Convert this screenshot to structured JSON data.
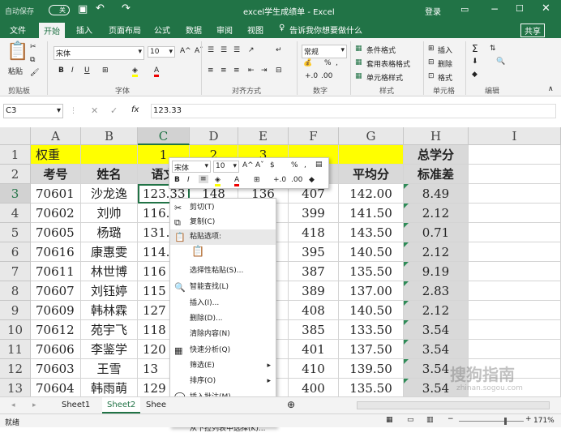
{
  "title": {
    "autosave": "自动保存",
    "autosave_state": "关",
    "filename": "excel学生成绩单 - Excel",
    "login": "登录"
  },
  "tabs": [
    "文件",
    "开始",
    "插入",
    "页面布局",
    "公式",
    "数据",
    "审阅",
    "视图"
  ],
  "tellme": "告诉我你想要做什么",
  "share": "共享",
  "ribbon": {
    "paste": "粘贴",
    "font_name": "宋体",
    "font_size": "10",
    "number_format": "常规",
    "cond_format": "条件格式",
    "table_format": "套用表格格式",
    "cell_style": "单元格样式",
    "insert": "插入",
    "delete": "删除",
    "format": "格式",
    "groups": {
      "clipboard": "剪贴板",
      "font": "字体",
      "align": "对齐方式",
      "number": "数字",
      "style": "样式",
      "cells": "单元格",
      "edit": "编辑"
    }
  },
  "formula": {
    "namebox": "C3",
    "fx": "fx",
    "value": "123.33"
  },
  "columns": [
    "A",
    "B",
    "C",
    "D",
    "E",
    "F",
    "G",
    "H",
    "I"
  ],
  "rows": [
    "1",
    "2",
    "3",
    "4",
    "5",
    "6",
    "7",
    "8",
    "9",
    "10",
    "11",
    "12",
    "13"
  ],
  "row1": {
    "a": "权重",
    "c": "1",
    "d": "2",
    "e": "3",
    "h": "总学分"
  },
  "row2": {
    "a": "考号",
    "b": "姓名",
    "c": "语文",
    "g": "平均分",
    "h": "标准差"
  },
  "data": [
    {
      "a": "70601",
      "b": "沙龙逸",
      "c": "123.33",
      "d": "148",
      "e": "136",
      "f": "407",
      "g": "142.00",
      "h": "8.49"
    },
    {
      "a": "70602",
      "b": "刘帅",
      "c": "116.",
      "d": "",
      "e": "",
      "f": "399",
      "g": "141.50",
      "h": "2.12"
    },
    {
      "a": "70605",
      "b": "杨璐",
      "c": "131.",
      "d": "",
      "e": "",
      "f": "418",
      "g": "143.50",
      "h": "0.71"
    },
    {
      "a": "70616",
      "b": "康惠雯",
      "c": "114.",
      "d": "",
      "e": "",
      "f": "395",
      "g": "140.50",
      "h": "2.12"
    },
    {
      "a": "70611",
      "b": "林世博",
      "c": "116",
      "d": "",
      "e": "",
      "f": "387",
      "g": "135.50",
      "h": "9.19"
    },
    {
      "a": "70607",
      "b": "刘钰婷",
      "c": "115",
      "d": "",
      "e": "",
      "f": "389",
      "g": "137.00",
      "h": "2.83"
    },
    {
      "a": "70609",
      "b": "韩林霖",
      "c": "127",
      "d": "",
      "e": "",
      "f": "408",
      "g": "140.50",
      "h": "2.12"
    },
    {
      "a": "70612",
      "b": "苑宇飞",
      "c": "118",
      "d": "",
      "e": "",
      "f": "385",
      "g": "133.50",
      "h": "3.54"
    },
    {
      "a": "70606",
      "b": "李鉴学",
      "c": "120",
      "d": "",
      "e": "",
      "f": "401",
      "g": "137.50",
      "h": "3.54"
    },
    {
      "a": "70603",
      "b": "王雪",
      "c": "13",
      "d": "",
      "e": "",
      "f": "410",
      "g": "139.50",
      "h": "3.54"
    },
    {
      "a": "70604",
      "b": "韩雨萌",
      "c": "129",
      "d": "",
      "e": "",
      "f": "400",
      "g": "135.50",
      "h": "3.54"
    }
  ],
  "mini": {
    "font": "宋体",
    "size": "10",
    "percent": "%",
    "comma": ","
  },
  "menu": [
    {
      "label": "剪切(T)",
      "icon": "cut-icon",
      "g": "✂"
    },
    {
      "label": "复制(C)",
      "icon": "copy-icon",
      "g": "⧉"
    },
    {
      "label": "粘贴选项:",
      "icon": "paste-icon",
      "g": "📋",
      "bold": true
    },
    {
      "label": "",
      "icon": "paste-option-icon",
      "g": "",
      "spacer": true
    },
    {
      "label": "选择性粘贴(S)...",
      "icon": "",
      "g": ""
    },
    {
      "label": "智能查找(L)",
      "icon": "smart-lookup-icon",
      "g": "🔍"
    },
    {
      "label": "插入(I)...",
      "icon": "",
      "g": ""
    },
    {
      "label": "删除(D)...",
      "icon": "",
      "g": ""
    },
    {
      "label": "清除内容(N)",
      "icon": "",
      "g": ""
    },
    {
      "label": "快速分析(Q)",
      "icon": "quick-analysis-icon",
      "g": "▦"
    },
    {
      "label": "筛选(E)",
      "icon": "",
      "g": "",
      "sub": true
    },
    {
      "label": "排序(O)",
      "icon": "",
      "g": "",
      "sub": true
    },
    {
      "label": "插入批注(M)",
      "icon": "comment-icon",
      "g": "💬"
    },
    {
      "label": "设置单元格格式(F)...",
      "icon": "format-cells-icon",
      "g": "▤"
    },
    {
      "label": "从下拉列表中选择(K)...",
      "icon": "",
      "g": ""
    }
  ],
  "sheets": [
    "Sheet1",
    "Sheet2",
    "Shee"
  ],
  "status": {
    "ready": "就绪",
    "zoom": "171%"
  },
  "watermark": {
    "text": "搜狗指南",
    "url": "zhinan.sogou.com"
  },
  "colors": {
    "excel_green": "#217346",
    "yellow": "#ffff00",
    "header_gray": "#d9d9d9"
  }
}
